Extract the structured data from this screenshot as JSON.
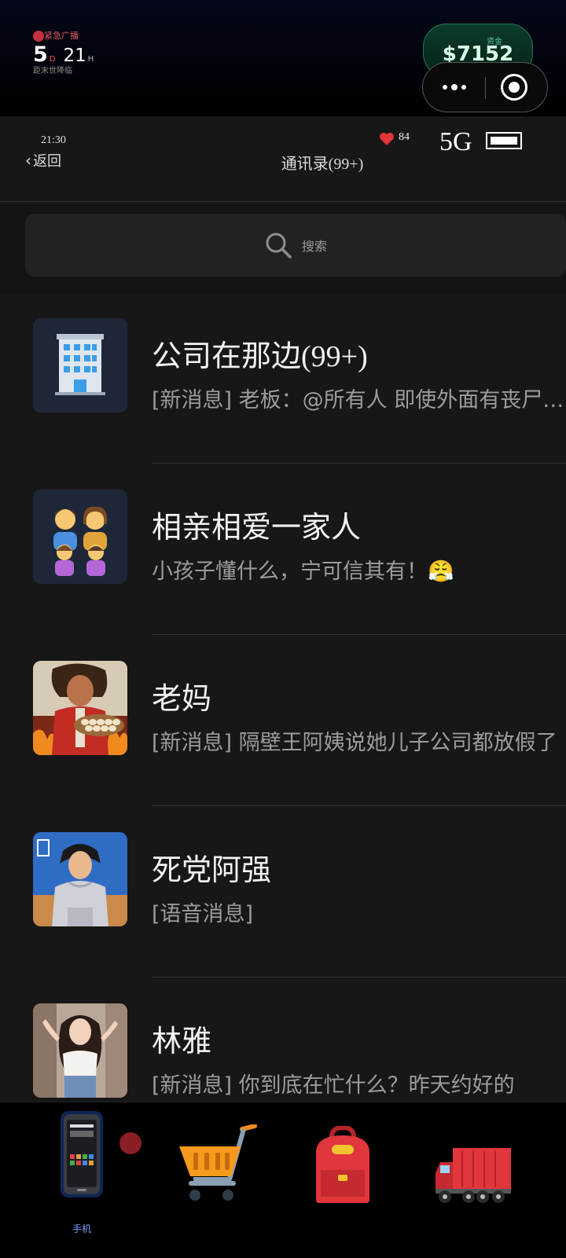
{
  "hud": {
    "alert_label": "紧急广播",
    "countdown_days": "5",
    "countdown_days_unit": "D",
    "countdown_hours": "21",
    "countdown_hours_unit": "H",
    "countdown_caption": "距末世降临",
    "funds_label": "资金",
    "funds_amount": "$7152"
  },
  "status_bar": {
    "time": "21:30",
    "hearts": "84",
    "signal": "5G"
  },
  "nav": {
    "back_label": "返回",
    "title": "通讯录(99+)"
  },
  "search": {
    "placeholder": "搜索"
  },
  "chats": [
    {
      "name": "公司在那边(99+)",
      "preview": "[新消息] 老板：@所有人 即使外面有丧尸，公司也要正常上班",
      "avatar_icon": "office-building-icon"
    },
    {
      "name": "相亲相爱一家人",
      "preview": "小孩子懂什么，宁可信其有！😤",
      "avatar_icon": "family-icon"
    },
    {
      "name": "老妈",
      "preview": "[新消息] 隔壁王阿姨说她儿子公司都放假了",
      "avatar_icon": "mom-portrait"
    },
    {
      "name": "死党阿强",
      "preview": "[语音消息]",
      "avatar_icon": "friend-portrait"
    },
    {
      "name": "林雅",
      "preview": "[新消息] 你到底在忙什么？昨天约好的",
      "avatar_icon": "girlfriend-portrait"
    }
  ],
  "tabs": [
    {
      "icon": "phone-icon",
      "label": "手机",
      "active": true,
      "badge": true
    },
    {
      "icon": "shopping-cart-icon",
      "label": ""
    },
    {
      "icon": "backpack-icon",
      "label": ""
    },
    {
      "icon": "truck-icon",
      "label": ""
    }
  ],
  "colors": {
    "background": "#171717",
    "accent_funds": "#0b3b2a",
    "alert_red": "#c7303e",
    "tab_label_blue": "#7fa0ff"
  }
}
